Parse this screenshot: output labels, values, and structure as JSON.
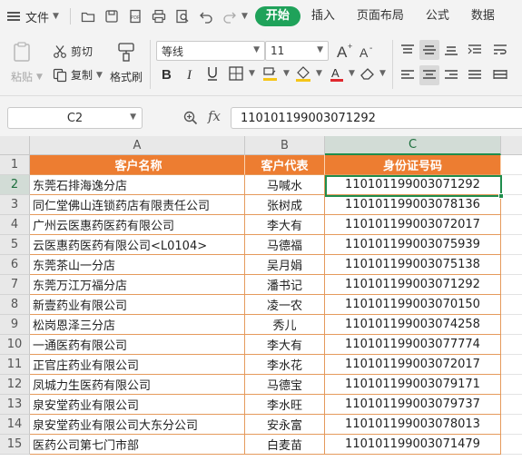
{
  "menubar": {
    "file_label": "文件",
    "tabs": [
      {
        "label": "开始",
        "active": true
      },
      {
        "label": "插入",
        "active": false
      },
      {
        "label": "页面布局",
        "active": false
      },
      {
        "label": "公式",
        "active": false
      },
      {
        "label": "数据",
        "active": false
      }
    ]
  },
  "ribbon": {
    "paste_label": "粘贴",
    "cut_label": "剪切",
    "copy_label": "复制",
    "format_painter_label": "格式刷",
    "font_name": "等线",
    "font_size": "11"
  },
  "formula_bar": {
    "name_box": "C2",
    "fx_label": "fx",
    "formula": "110101199003071292"
  },
  "sheet": {
    "columns": [
      "A",
      "B",
      "C"
    ],
    "selected_column": "C",
    "selected_row": "2",
    "header_row": {
      "row": "1",
      "a": "客户名称",
      "b": "客户代表",
      "c": "身份证号码"
    },
    "rows": [
      {
        "row": "2",
        "a": "东莞石排海逸分店",
        "b": "马喊水",
        "c": "110101199003071292"
      },
      {
        "row": "3",
        "a": "同仁堂佛山连锁药店有限责任公司",
        "b": "张树成",
        "c": "110101199003078136"
      },
      {
        "row": "4",
        "a": "广州云医惠药医药有限公司",
        "b": "李大有",
        "c": "110101199003072017"
      },
      {
        "row": "5",
        "a": "云医惠药医药有限公司<L0104>",
        "b": "马德福",
        "c": "110101199003075939"
      },
      {
        "row": "6",
        "a": "东莞茶山一分店",
        "b": "吴月娟",
        "c": "110101199003075138"
      },
      {
        "row": "7",
        "a": "东莞万江万福分店",
        "b": "潘书记",
        "c": "110101199003071292"
      },
      {
        "row": "8",
        "a": "新壹药业有限公司",
        "b": "凌一农",
        "c": "110101199003070150"
      },
      {
        "row": "9",
        "a": "松岗恩泽三分店",
        "b": "秀儿",
        "c": "110101199003074258"
      },
      {
        "row": "10",
        "a": "一通医药有限公司",
        "b": "李大有",
        "c": "110101199003077774"
      },
      {
        "row": "11",
        "a": "正官庄药业有限公司",
        "b": "李水花",
        "c": "110101199003072017"
      },
      {
        "row": "12",
        "a": "凤城力生医药有限公司",
        "b": "马德宝",
        "c": "110101199003079171"
      },
      {
        "row": "13",
        "a": "泉安堂药业有限公司",
        "b": "李水旺",
        "c": "110101199003079737"
      },
      {
        "row": "14",
        "a": "泉安堂药业有限公司大东分公司",
        "b": "安永富",
        "c": "110101199003078013"
      },
      {
        "row": "15",
        "a": "医药公司第七门市部",
        "b": "白麦苗",
        "c": "110101199003071479"
      }
    ]
  },
  "colors": {
    "accent_green": "#1fa25a",
    "header_orange": "#ed7d31",
    "border_orange": "#e59a5c"
  }
}
